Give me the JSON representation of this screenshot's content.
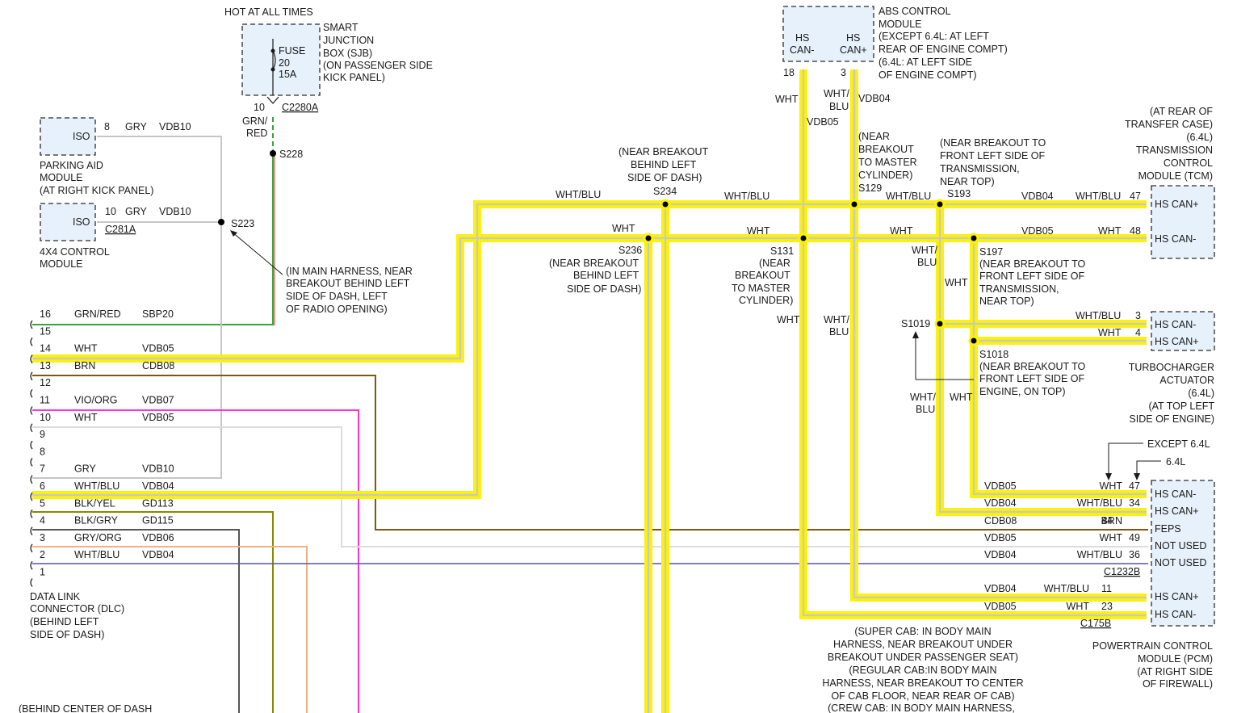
{
  "colors": {
    "highlight": "#fbf10a",
    "can_wire": "#c8c8c8",
    "grn_red": "#3aa33a",
    "red": "#d63a2a",
    "gry": "#c6c6c6",
    "brn": "#7a5a10",
    "vio_org": "#ff33cc",
    "wht": "#dcdcdc",
    "blk_yel": "#6b6b00",
    "blk_gry": "#555555",
    "gry_org": "#f0b080",
    "wht_blu": "#5555aa",
    "module_fill": "#e6f1fb"
  },
  "icons": {
    "splice": "filled-circle",
    "connector": "bracket",
    "fuse": "fuse-symbol",
    "arrow": "leader-arrow"
  },
  "top": {
    "hot": "HOT AT ALL TIMES",
    "sjb_lines": [
      "SMART",
      "JUNCTION",
      "BOX (SJB)",
      "(ON PASSENGER SIDE",
      "KICK PANEL)"
    ],
    "fuse_lines": [
      "FUSE",
      "20",
      "15A"
    ],
    "pin10": "10",
    "c2280a": "C2280A",
    "grn_red_lines": [
      "GRN/",
      "RED"
    ],
    "s228": "S228"
  },
  "parking": {
    "iso": "ISO",
    "pin": "8",
    "color": "GRY",
    "circuit": "VDB10",
    "lines": [
      "PARKING AID",
      "MODULE",
      "(AT RIGHT KICK PANEL)"
    ]
  },
  "fourx4": {
    "iso": "ISO",
    "pin": "10",
    "color": "GRY",
    "circuit": "VDB10",
    "connector": "C281A",
    "lines": [
      "4X4 CONTROL",
      "MODULE"
    ]
  },
  "s223": {
    "label": "S223",
    "note_lines": [
      "(IN MAIN HARNESS, NEAR",
      "BREAKOUT BEHIND LEFT",
      "SIDE OF DASH, LEFT",
      "OF RADIO OPENING)"
    ]
  },
  "dlc": {
    "pins": [
      {
        "pin": "16",
        "color": "GRN/RED",
        "circuit": "SBP20"
      },
      {
        "pin": "15",
        "color": "",
        "circuit": ""
      },
      {
        "pin": "14",
        "color": "WHT",
        "circuit": "VDB05"
      },
      {
        "pin": "13",
        "color": "BRN",
        "circuit": "CDB08"
      },
      {
        "pin": "12",
        "color": "",
        "circuit": ""
      },
      {
        "pin": "11",
        "color": "VIO/ORG",
        "circuit": "VDB07"
      },
      {
        "pin": "10",
        "color": "WHT",
        "circuit": "VDB05"
      },
      {
        "pin": "9",
        "color": "",
        "circuit": ""
      },
      {
        "pin": "8",
        "color": "",
        "circuit": ""
      },
      {
        "pin": "7",
        "color": "GRY",
        "circuit": "VDB10"
      },
      {
        "pin": "6",
        "color": "WHT/BLU",
        "circuit": "VDB04"
      },
      {
        "pin": "5",
        "color": "BLK/YEL",
        "circuit": "GD113"
      },
      {
        "pin": "4",
        "color": "BLK/GRY",
        "circuit": "GD115"
      },
      {
        "pin": "3",
        "color": "GRY/ORG",
        "circuit": "VDB06"
      },
      {
        "pin": "2",
        "color": "WHT/BLU",
        "circuit": "VDB04"
      },
      {
        "pin": "1",
        "color": "",
        "circuit": ""
      }
    ],
    "lines": [
      "DATA LINK",
      "CONNECTOR (DLC)",
      "(BEHIND LEFT",
      "SIDE OF DASH)"
    ],
    "bottom": "(BEHIND CENTER OF DASH"
  },
  "s234": {
    "note_lines": [
      "(NEAR BREAKOUT",
      "BEHIND LEFT",
      "SIDE OF DASH)"
    ],
    "label": "S234",
    "wire_left": "WHT/BLU",
    "wire_right": "WHT/BLU"
  },
  "s236": {
    "wire": "WHT",
    "label": "S236",
    "note_lines": [
      "(NEAR BREAKOUT",
      "BEHIND LEFT",
      "SIDE OF DASH)"
    ],
    "wire_right": "WHT"
  },
  "abs": {
    "pin_minus_lines": [
      "HS",
      "CAN-"
    ],
    "pin_plus_lines": [
      "HS",
      "CAN+"
    ],
    "pin18": "18",
    "pin3": "3",
    "title_lines": [
      "ABS CONTROL",
      "MODULE",
      "(EXCEPT 6.4L: AT LEFT",
      "REAR OF ENGINE COMPT)",
      "(6.4L: AT LEFT SIDE",
      "OF ENGINE COMPT)"
    ],
    "wht": "WHT",
    "wht_blu_lines": [
      "WHT/",
      "BLU"
    ],
    "vdb04": "VDB04",
    "vdb05": "VDB05"
  },
  "s129": {
    "note_lines": [
      "(NEAR",
      "BREAKOUT",
      "TO MASTER",
      "CYLINDER)"
    ],
    "label": "S129"
  },
  "s193": {
    "note_lines": [
      "(NEAR BREAKOUT TO",
      "FRONT LEFT SIDE OF",
      "TRANSMISSION,",
      "NEAR TOP)"
    ],
    "label": "S193",
    "wire_left": "WHT/BLU"
  },
  "s131": {
    "label": "S131",
    "note_lines": [
      "(NEAR",
      "BREAKOUT",
      "TO MASTER",
      "CYLINDER)"
    ],
    "wht": "WHT",
    "wht_blu_lines": [
      "WHT/",
      "BLU"
    ],
    "wire_right": "WHT"
  },
  "s197": {
    "label": "S197",
    "note_lines": [
      "(NEAR BREAKOUT TO",
      "FRONT LEFT SIDE OF",
      "TRANSMISSION,",
      "NEAR TOP)"
    ],
    "wht_blu_lines": [
      "WHT/",
      "BLU"
    ],
    "wht": "WHT"
  },
  "tcm": {
    "lines": [
      "(AT REAR OF",
      "TRANSFER CASE)",
      "(6.4L)",
      "TRANSMISSION",
      "CONTROL",
      "MODULE (TCM)"
    ],
    "row1": {
      "circuit": "VDB04",
      "color": "WHT/BLU",
      "pin": "47",
      "name": "HS CAN+"
    },
    "row2": {
      "circuit": "VDB05",
      "color": "WHT",
      "pin": "48",
      "name": "HS CAN-"
    }
  },
  "turbo": {
    "s1019": "S1019",
    "s1018": "S1018",
    "s1018_note": [
      "(NEAR BREAKOUT TO",
      "FRONT LEFT SIDE OF",
      "ENGINE, ON TOP)"
    ],
    "row1": {
      "color": "WHT/BLU",
      "pin": "3",
      "name": "HS CAN-"
    },
    "row2": {
      "color": "WHT",
      "pin": "4",
      "name": "HS CAN+"
    },
    "lines": [
      "TURBOCHARGER",
      "ACTUATOR",
      "(6.4L)",
      "(AT TOP LEFT",
      "SIDE OF ENGINE)"
    ],
    "wht_blu_lines": [
      "WHT/",
      "BLU"
    ],
    "wht": "WHT"
  },
  "pcm": {
    "except": "EXCEPT 6.4L",
    "six4": "6.4L",
    "rows": [
      {
        "circuit": "VDB05",
        "color": "WHT",
        "pin": "47",
        "name": "HS CAN-"
      },
      {
        "circuit": "VDB04",
        "color": "WHT/BLU",
        "pin": "34",
        "name": "HS CAN+"
      },
      {
        "circuit": "CDB08",
        "color": "BRN",
        "pin": "44",
        "name": "FEPS"
      },
      {
        "circuit": "VDB05",
        "color": "WHT",
        "pin": "49",
        "name": "NOT USED"
      },
      {
        "circuit": "VDB04",
        "color": "WHT/BLU",
        "pin": "36",
        "name": "NOT USED"
      }
    ],
    "c1232b": "C1232B",
    "rows2": [
      {
        "circuit": "VDB04",
        "color": "WHT/BLU",
        "pin": "11",
        "name": "HS CAN+"
      },
      {
        "circuit": "VDB05",
        "color": "WHT",
        "pin": "23",
        "name": "HS CAN-"
      }
    ],
    "c175b": "C175B",
    "lines": [
      "POWERTRAIN CONTROL",
      "MODULE (PCM)",
      "(AT RIGHT SIDE",
      "OF FIREWALL)"
    ]
  },
  "bottom_note": [
    "(SUPER CAB: IN BODY MAIN",
    "HARNESS, NEAR BREAKOUT UNDER",
    "BREAKOUT UNDER PASSENGER SEAT)",
    "(REGULAR CAB:IN BODY MAIN",
    "HARNESS, NEAR BREAKOUT TO CENTER",
    "OF CAB FLOOR, NEAR REAR OF CAB)",
    "(CREW CAB: IN BODY MAIN HARNESS,"
  ]
}
